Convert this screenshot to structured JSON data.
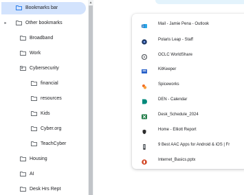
{
  "folders": [
    {
      "label": "Bookmarks bar",
      "arrow": "",
      "icon": "folder-icon",
      "selected": true
    },
    {
      "label": "Other bookmarks",
      "arrow": "▸",
      "icon": "folder-icon"
    },
    {
      "label": "Broadband",
      "arrow": "",
      "icon": "folder-icon"
    },
    {
      "label": "Work",
      "arrow": "",
      "icon": "folder-icon"
    },
    {
      "label": "Cybersecurity",
      "arrow": "▾",
      "icon": "folder-icon"
    },
    {
      "label": "financial",
      "arrow": "",
      "icon": "folder-icon"
    },
    {
      "label": "resources",
      "arrow": "",
      "icon": "folder-icon"
    },
    {
      "label": "Kids",
      "arrow": "",
      "icon": "folder-icon"
    },
    {
      "label": "Cyber.org",
      "arrow": "",
      "icon": "folder-icon"
    },
    {
      "label": "TeachCyber",
      "arrow": "",
      "icon": "folder-icon"
    },
    {
      "label": "Housing",
      "arrow": "",
      "icon": "folder-icon"
    },
    {
      "label": "AI",
      "arrow": "",
      "icon": "folder-icon"
    },
    {
      "label": "Desk Hrs Rept",
      "arrow": "",
      "icon": "folder-icon"
    }
  ],
  "bookmarks": [
    {
      "label": "Mail - Jamie Pena - Outlook",
      "icon": "outlook-icon",
      "color": "#0f6cbd"
    },
    {
      "label": "Polaris Leap - Staff",
      "icon": "polaris-icon",
      "color": "#1f3a68"
    },
    {
      "label": "OCLC WorldShare",
      "icon": "oclc-icon",
      "color": "#5f6368"
    },
    {
      "label": "KitKeeper",
      "icon": "kitkeeper-icon",
      "color": "#2a62c9"
    },
    {
      "label": "Spiceworks",
      "icon": "spiceworks-icon",
      "color": "#f26b21"
    },
    {
      "label": "DEN - Calendar",
      "icon": "den-icon",
      "color": "#00897b"
    },
    {
      "label": "Desk_Schedule_2024",
      "icon": "excel-icon",
      "color": "#1e7b45"
    },
    {
      "label": "Home - Elliott Report",
      "icon": "shield-icon",
      "color": "#2b2b2b"
    },
    {
      "label": "9 Best AAC Apps for Android & iOS | Fr",
      "icon": "phone-icon",
      "color": "#3c4043"
    },
    {
      "label": "Internet_Basics.pptx",
      "icon": "powerpoint-icon",
      "color": "#d24726"
    }
  ],
  "colors": {
    "selected_bg": "#d3e3fd",
    "scrollbar_thumb": "#c1c4c8"
  }
}
